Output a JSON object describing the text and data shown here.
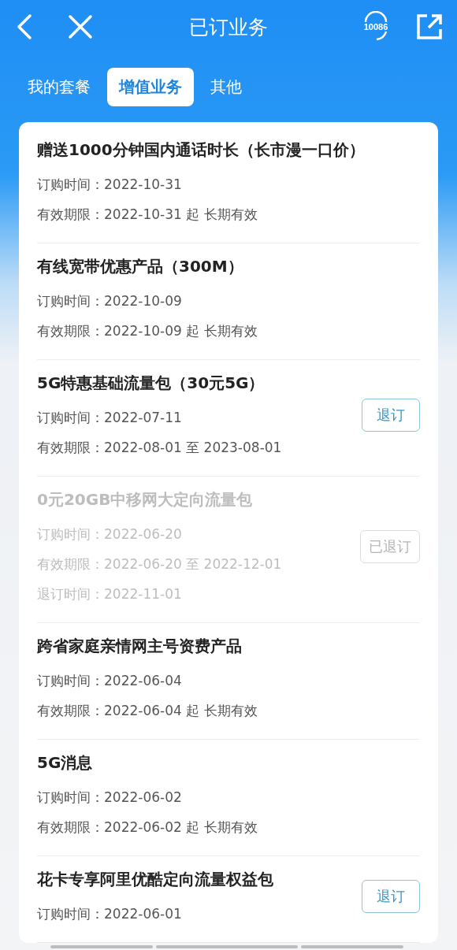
{
  "header": {
    "title": "已订业务",
    "hotline": "10086"
  },
  "tabs": [
    {
      "label": "我的套餐",
      "selected": false
    },
    {
      "label": "增值业务",
      "selected": true
    },
    {
      "label": "其他",
      "selected": false
    }
  ],
  "items": [
    {
      "title": "赠送1000分钟国内通话时长（长市漫一口价）",
      "cancelled": false,
      "lines": [
        "订购时间：2022-10-31",
        "有效期限：2022-10-31 起 长期有效"
      ]
    },
    {
      "title": "有线宽带优惠产品（300M）",
      "cancelled": false,
      "lines": [
        "订购时间：2022-10-09",
        "有效期限：2022-10-09 起 长期有效"
      ]
    },
    {
      "title": "5G特惠基础流量包（30元5G）",
      "cancelled": false,
      "button": "退订",
      "lines": [
        "订购时间：2022-07-11",
        "有效期限：2022-08-01 至 2023-08-01"
      ]
    },
    {
      "title": "0元20GB中移网大定向流量包",
      "cancelled": true,
      "button": "已退订",
      "lines": [
        "订购时间：2022-06-20",
        "有效期限：2022-06-20 至 2022-12-01",
        "退订时间：2022-11-01"
      ]
    },
    {
      "title": "跨省家庭亲情网主号资费产品",
      "cancelled": false,
      "lines": [
        "订购时间：2022-06-04",
        "有效期限：2022-06-04 起 长期有效"
      ]
    },
    {
      "title": "5G消息",
      "cancelled": false,
      "lines": [
        "订购时间：2022-06-02",
        "有效期限：2022-06-02 起 长期有效"
      ]
    },
    {
      "title": "花卡专享阿里优酷定向流量权益包",
      "cancelled": false,
      "button": "退订",
      "lines": [
        "订购时间：2022-06-01"
      ]
    }
  ]
}
